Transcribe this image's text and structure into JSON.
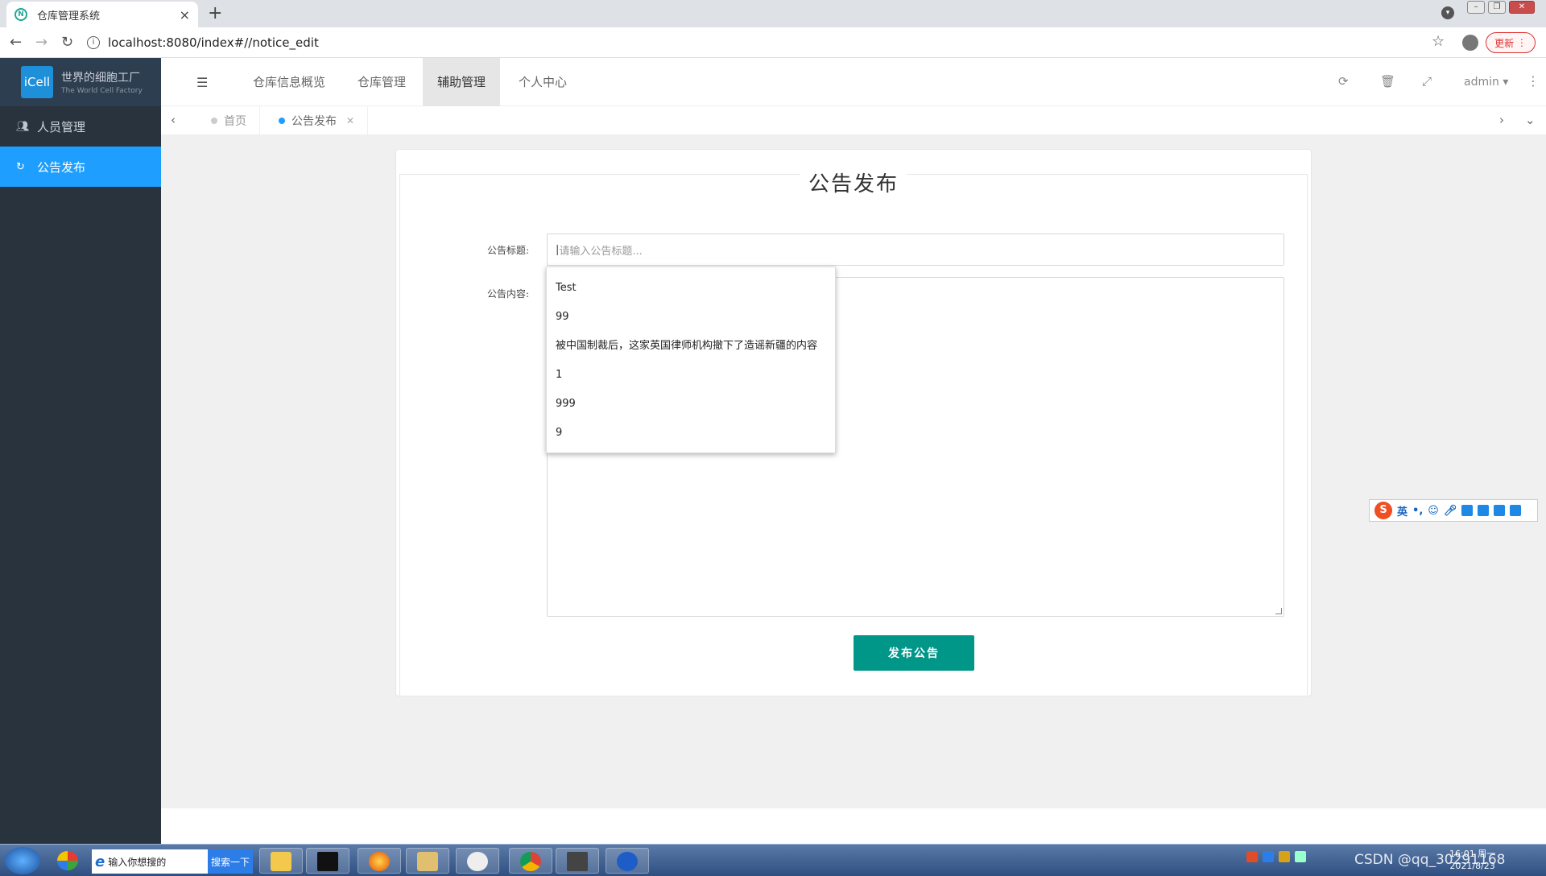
{
  "browser": {
    "tab_title": "仓库管理系统",
    "url": "localhost:8080/index#//notice_edit",
    "update_label": "更新"
  },
  "logo": {
    "brand": "iCell",
    "line1": "世界的细胞工厂",
    "line2": "The World Cell Factory"
  },
  "sidebar": {
    "items": [
      {
        "label": "人员管理",
        "icon": "users-icon"
      },
      {
        "label": "公告发布",
        "icon": "refresh-icon"
      }
    ]
  },
  "header": {
    "nav": [
      "仓库信息概览",
      "仓库管理",
      "辅助管理",
      "个人中心"
    ],
    "user": "admin"
  },
  "tabs": {
    "home": "首页",
    "current": "公告发布"
  },
  "form": {
    "title": "公告发布",
    "title_label": "公告标题:",
    "content_label": "公告内容:",
    "title_placeholder": "请输入公告标题...",
    "submit_label": "发布公告"
  },
  "autocomplete": [
    "Test",
    "99",
    "被中国制裁后，这家英国律师机构撤下了造谣新疆的内容",
    "1",
    "999",
    "9"
  ],
  "ime": {
    "mode": "英"
  },
  "taskbar": {
    "search_placeholder": "输入你想搜的",
    "search_button": "搜索一下",
    "clock_time": "16:01 周一",
    "clock_date": "2021/8/23",
    "watermark": "CSDN @qq_30291168"
  },
  "colors": {
    "sidebar_bg": "#28333e",
    "active_blue": "#1e9fff",
    "submit_green": "#009688"
  }
}
